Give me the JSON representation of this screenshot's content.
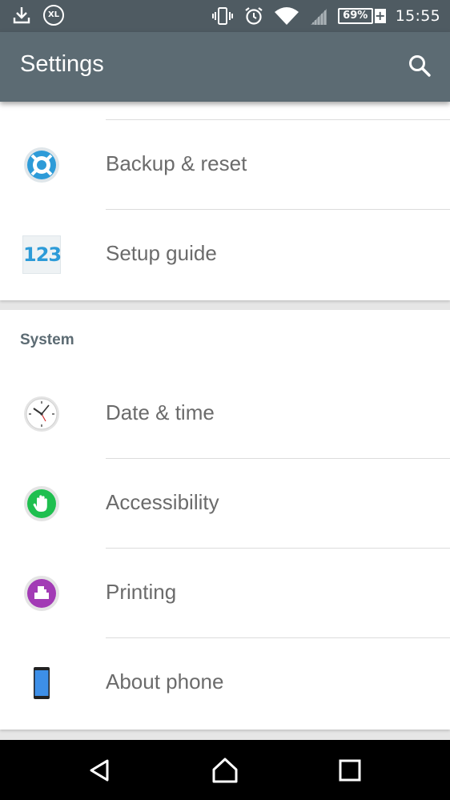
{
  "status_bar": {
    "time": "15:55",
    "battery_percent": "69%",
    "battery_charging_symbol": "+",
    "data_saver_label": "XL",
    "icons": [
      "download-icon",
      "xl-icon",
      "vibrate-icon",
      "alarm-icon",
      "wifi-icon",
      "signal-icon",
      "battery-icon"
    ]
  },
  "app_bar": {
    "title": "Settings",
    "search_icon": "search-icon"
  },
  "personal_items": [
    {
      "label": "Backup & reset",
      "icon": "backup-reset-icon",
      "icon_color": "#2d9bd8"
    },
    {
      "label": "Setup guide",
      "icon": "setup-guide-icon",
      "icon_text": "123",
      "icon_color": "#2d9bd8"
    }
  ],
  "system_section": {
    "header": "System",
    "items": [
      {
        "label": "Date & time",
        "icon": "clock-icon"
      },
      {
        "label": "Accessibility",
        "icon": "accessibility-hand-icon",
        "icon_color": "#1fbf4f"
      },
      {
        "label": "Printing",
        "icon": "printing-icon",
        "icon_color": "#a23bb5"
      },
      {
        "label": "About phone",
        "icon": "phone-icon",
        "icon_color": "#3d8fe8"
      }
    ]
  },
  "nav_bar": {
    "back_icon": "back-icon",
    "home_icon": "home-icon",
    "recents_icon": "recents-icon"
  },
  "colors": {
    "status_bar": "#4f5b62",
    "app_bar": "#5c6b73",
    "accent_header": "#5c6b73"
  }
}
